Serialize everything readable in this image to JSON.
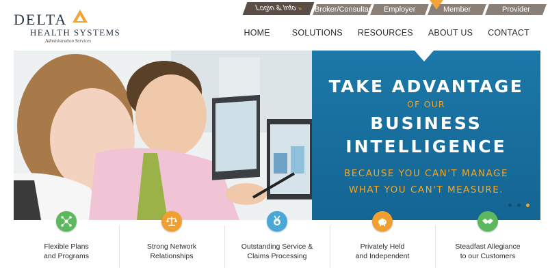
{
  "logo": {
    "word": "DELTA",
    "subtitle": "HEALTH SYSTEMS",
    "tagline": "Administration Services"
  },
  "portal_tabs": {
    "login": "Login & Info",
    "login_arrow": "»",
    "broker": "Broker/Consultant",
    "employer": "Employer",
    "member": "Member",
    "provider": "Provider"
  },
  "nav": {
    "home": "HOME",
    "solutions": "SOLUTIONS",
    "resources": "RESOURCES",
    "about": "ABOUT US",
    "contact": "CONTACT"
  },
  "hero": {
    "line1": "TAKE ADVANTAGE",
    "line2": "OF OUR",
    "line3": "BUSINESS",
    "line4": "INTELLIGENCE",
    "line5": "BECAUSE YOU CAN'T MANAGE",
    "line6": "WHAT YOU CAN'T MEASURE.",
    "slide_count": 3,
    "active_slide": 3
  },
  "features": [
    {
      "line1": "Flexible Plans",
      "line2": "and Programs",
      "icon": "network-icon",
      "color": "#5cb85c"
    },
    {
      "line1": "Strong Network",
      "line2": "Relationships",
      "icon": "scales-icon",
      "color": "#f0a030"
    },
    {
      "line1": "Outstanding Service &",
      "line2": "Claims Processing",
      "icon": "award-icon",
      "color": "#4aa8d8"
    },
    {
      "line1": "Privately Held",
      "line2": "and Independent",
      "icon": "piggy-bank-icon",
      "color": "#f0a030"
    },
    {
      "line1": "Steadfast Allegiance",
      "line2": "to our Customers",
      "icon": "handshake-icon",
      "color": "#5cb85c"
    }
  ],
  "colors": {
    "accent_orange": "#f5a623",
    "panel_blue": "#1b78a8",
    "tab_brown": "#8a7f77",
    "login_brown": "#5a4e46"
  }
}
